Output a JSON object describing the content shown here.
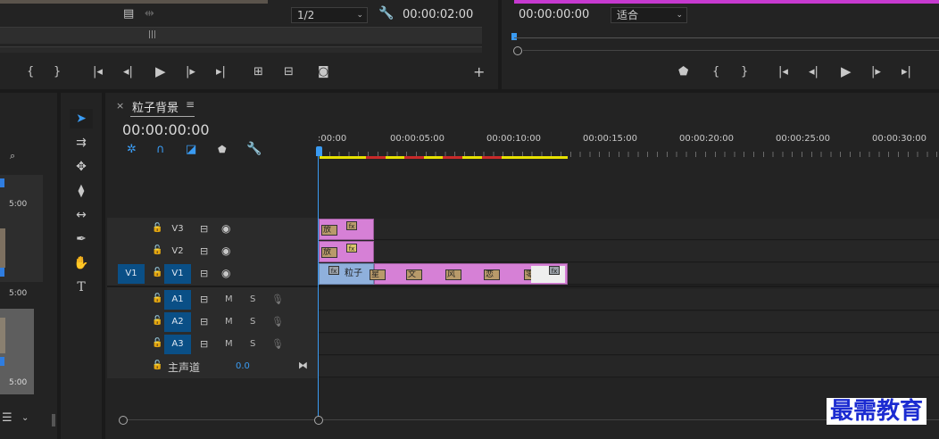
{
  "source_monitor": {
    "resolution": "1/2",
    "timecode": "00:00:02:00"
  },
  "program_monitor": {
    "timecode": "00:00:00:00",
    "fit": "适合"
  },
  "timeline": {
    "close": "×",
    "sequence_name": "粒子背景",
    "menu": "≡",
    "playhead_timecode": "00:00:00:00",
    "ruler": [
      ":00:00",
      "00:00:05:00",
      "00:00:10:00",
      "00:00:15:00",
      "00:00:20:00",
      "00:00:25:00",
      "00:00:30:00"
    ],
    "video_tracks": [
      {
        "name": "V3"
      },
      {
        "name": "V2"
      },
      {
        "name": "V1",
        "source": "V1"
      }
    ],
    "audio_tracks": [
      {
        "name": "A1",
        "m": "M",
        "s": "S"
      },
      {
        "name": "A2",
        "m": "M",
        "s": "S"
      },
      {
        "name": "A3",
        "m": "M",
        "s": "S"
      }
    ],
    "master": {
      "label": "主声道",
      "value": "0.0"
    },
    "clips": {
      "v3_label": "放",
      "v2_label": "放",
      "v1_label": "粒子",
      "fx": "fx",
      "sub_labels": [
        "星",
        "文",
        "风",
        "恋",
        "零"
      ]
    }
  },
  "project_panel": {
    "times": [
      "5:00",
      "5:00",
      "5:00"
    ]
  },
  "watermark": "最需教育",
  "colors": {
    "accent_blue": "#3a9bf2",
    "track_on": "#0a4f86",
    "clip_pink": "#d680d6",
    "work_area_yellow": "#e7e100",
    "render_red": "#c92a2a",
    "watermark": "#1b2bd1"
  }
}
